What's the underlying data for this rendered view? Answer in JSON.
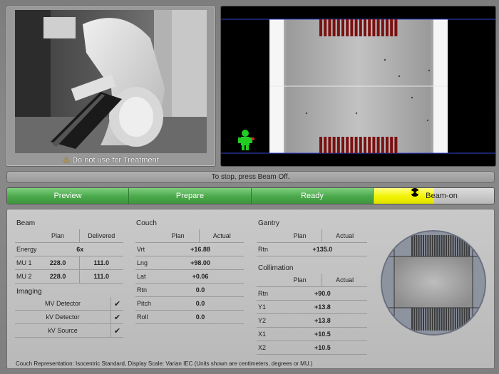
{
  "camera": {
    "caption": "Do not use for Treatment",
    "warning_icon": "warning-triangle-icon"
  },
  "status_message": "To stop, press Beam Off.",
  "workflow": {
    "steps": [
      "Preview",
      "Prepare",
      "Ready"
    ],
    "beam_on_label": "Beam-on",
    "beam_progress": 0.5,
    "beam_icon": "radiation-icon",
    "colors": {
      "done": "#4aa84a",
      "active": "#f2f200"
    }
  },
  "beam": {
    "title": "Beam",
    "col_plan": "Plan",
    "col_delivered": "Delivered",
    "energy_label": "Energy",
    "energy_value": "6x",
    "rows": [
      {
        "label": "MU 1",
        "plan": "228.0",
        "delivered": "111.0"
      },
      {
        "label": "MU 2",
        "plan": "228.0",
        "delivered": "111.0"
      }
    ]
  },
  "imaging": {
    "title": "Imaging",
    "items": [
      {
        "label": "MV Detector",
        "checked": "✔"
      },
      {
        "label": "kV Detector",
        "checked": "✔"
      },
      {
        "label": "kV Source",
        "checked": "✔"
      }
    ]
  },
  "couch": {
    "title": "Couch",
    "col_plan": "Plan",
    "col_actual": "Actual",
    "rows": [
      {
        "label": "Vrt",
        "value": "+16.88"
      },
      {
        "label": "Lng",
        "value": "+98.00"
      },
      {
        "label": "Lat",
        "value": "+0.06"
      },
      {
        "label": "Rtn",
        "value": "0.0"
      },
      {
        "label": "Pitch",
        "value": "0.0"
      },
      {
        "label": "Roll",
        "value": "0.0"
      }
    ]
  },
  "gantry": {
    "title": "Gantry",
    "col_plan": "Plan",
    "col_actual": "Actual",
    "rows": [
      {
        "label": "Rtn",
        "value": "+135.0"
      }
    ]
  },
  "collimation": {
    "title": "Collimation",
    "col_plan": "Plan",
    "col_actual": "Actual",
    "rows": [
      {
        "label": "Rtn",
        "value": "+90.0"
      },
      {
        "label": "Y1",
        "value": "+13.8"
      },
      {
        "label": "Y2",
        "value": "+13.8"
      },
      {
        "label": "X1",
        "value": "+10.5"
      },
      {
        "label": "X2",
        "value": "+10.5"
      }
    ]
  },
  "footer_note": "Couch Representation: Isocentric Standard, Display Scale: Varian IEC (Units shown are centimeters, degrees or MU.)"
}
